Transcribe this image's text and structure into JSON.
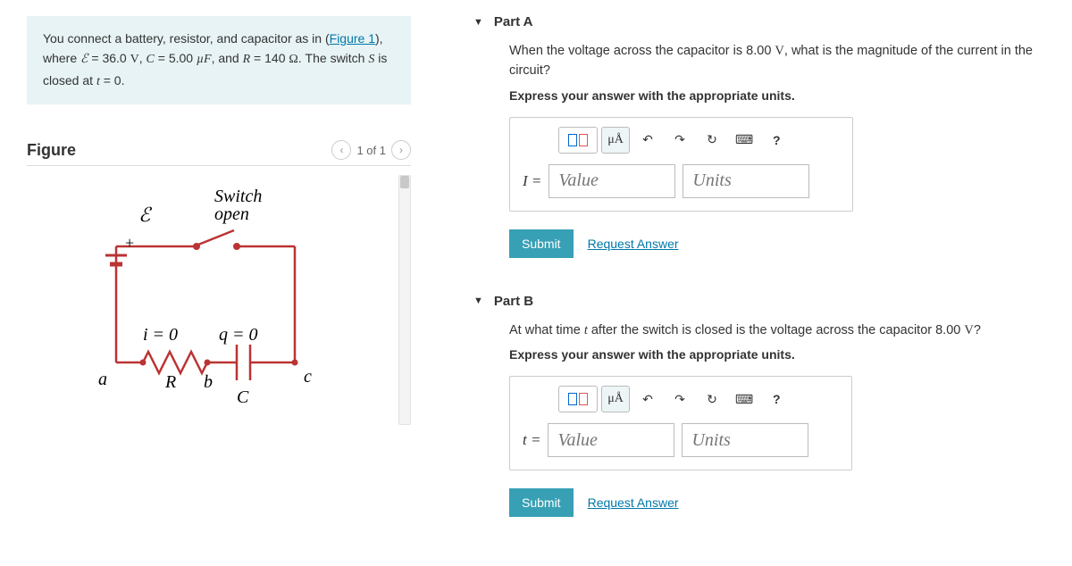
{
  "problem": {
    "intro": "You connect a battery, resistor, and capacitor as in (",
    "figure_link": "Figure 1",
    "after_link": "), where ",
    "emf_sym": "ℰ",
    "emf_val": " = 36.0 ",
    "emf_unit": "V",
    "c_text": ", ",
    "c_sym": "C",
    "c_val": " = 5.00 ",
    "c_unit": "µF",
    "r_text": ", and ",
    "r_sym": "R",
    "r_val": " = 140 ",
    "r_unit": "Ω",
    "close_text": ". The switch ",
    "s_sym": "S",
    "close_text2": " is closed at ",
    "t_sym": "t",
    "t_val": " = 0."
  },
  "figure": {
    "title": "Figure",
    "pager": "1 of 1",
    "labels": {
      "switch": "Switch",
      "open": "open",
      "emf": "ℰ",
      "plus": "+",
      "i0": "i = 0",
      "q0": "q = 0",
      "a": "a",
      "b": "b",
      "c": "c",
      "R": "R",
      "C": "C"
    }
  },
  "partA": {
    "title": "Part A",
    "question_pre": "When the voltage across the capacitor is 8.00 ",
    "question_unit": "V",
    "question_post": ", what is the magnitude of the current in the circuit?",
    "instruction": "Express your answer with the appropriate units.",
    "var": "I =",
    "value_ph": "Value",
    "units_ph": "Units",
    "submit": "Submit",
    "request": "Request Answer"
  },
  "partB": {
    "title": "Part B",
    "question_pre": "At what time ",
    "question_sym": "t",
    "question_mid": " after the switch is closed is the voltage across the capacitor 8.00 ",
    "question_unit": "V",
    "question_post": "?",
    "instruction": "Express your answer with the appropriate units.",
    "var": "t =",
    "value_ph": "Value",
    "units_ph": "Units",
    "submit": "Submit",
    "request": "Request Answer"
  },
  "toolbar": {
    "mu_a": "μÅ",
    "undo": "↶",
    "redo": "↷",
    "reset": "↻",
    "keyboard": "⌨",
    "help": "?"
  }
}
